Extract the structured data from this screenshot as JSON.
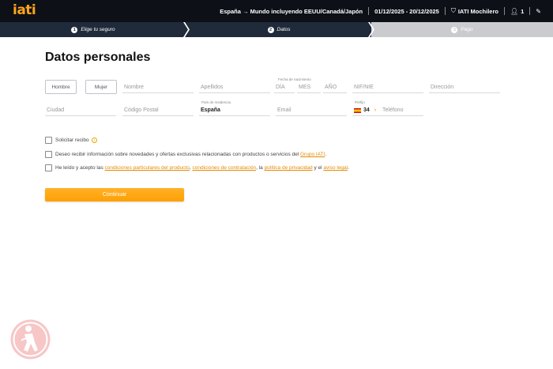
{
  "header": {
    "logo": "iati",
    "trip": "España → Mundo incluyendo EEUU/Canadá/Japón",
    "dates": "01/12/2025 - 20/12/2025",
    "product": "IATI Mochilero",
    "travelers": "1"
  },
  "steps": [
    {
      "num": "1",
      "label": "Elige tu seguro"
    },
    {
      "num": "2",
      "label": "Datos"
    },
    {
      "num": "3",
      "label": "Pago"
    }
  ],
  "form": {
    "title": "Datos personales",
    "hombre": "Hombre",
    "mujer": "Mujer",
    "nombre": "Nombre",
    "apellidos": "Apellidos",
    "fecha_label": "Fecha de nacimiento",
    "dia": "DÍA",
    "mes": "MES",
    "anio": "AÑO",
    "nif": "NIF/NIE",
    "direccion": "Dirección",
    "ciudad": "Ciudad",
    "cp": "Código Postal",
    "pais_label": "País de residencia",
    "pais": "España",
    "email": "Email",
    "prefijo_label": "Prefijo",
    "prefijo": "34",
    "telefono": "Teléfono"
  },
  "checks": {
    "recibo": "Solicitar recibo",
    "novedades_text": "Deseo recibir información sobre novedades y ofertas exclusivas relacionadas con productos o servicios del",
    "grupo_iati": "Grupo IATI",
    "legal_pre": "He leído y acepto las",
    "condiciones_particulares": "condiciones particulares del producto",
    "condiciones_contratacion": "condiciones de contratación",
    "politica": "política de privacidad",
    "aviso": "aviso legal",
    "comma": ",",
    "la": "la",
    "y_el": "y el",
    "dot": "."
  },
  "continue_label": "Continuar",
  "colors": {
    "accent": "#ffa41b",
    "header_bg": "#0d1117",
    "step_active": "#1f2a3a",
    "step_inactive": "#c9cbcf",
    "badge": "#f7c6c6"
  }
}
